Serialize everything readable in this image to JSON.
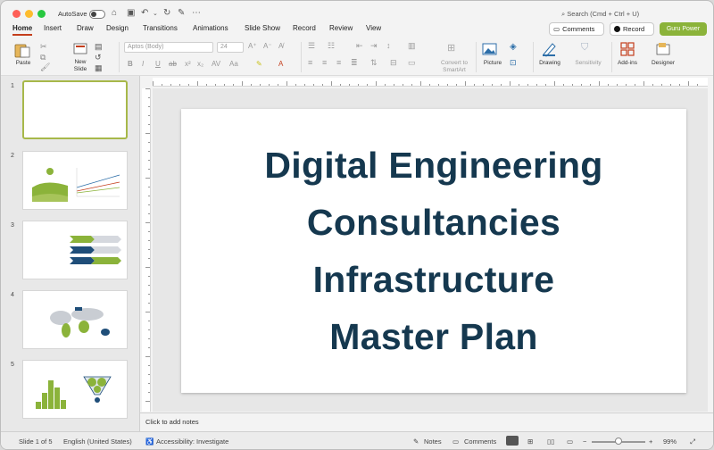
{
  "window": {
    "autosave_label": "AutoSave",
    "search_placeholder": "Search (Cmd + Ctrl + U)"
  },
  "tabs": [
    "Home",
    "Insert",
    "Draw",
    "Design",
    "Transitions",
    "Animations",
    "Slide Show",
    "Record",
    "Review",
    "View"
  ],
  "header_buttons": {
    "comments": "Comments",
    "record": "Record",
    "guru": "Guru Power"
  },
  "ribbon": {
    "paste": "Paste",
    "new_slide_1": "New",
    "new_slide_2": "Slide",
    "font_name": "Aptos (Body)",
    "font_size": "24",
    "convert_1": "Convert to",
    "convert_2": "SmartArt",
    "picture": "Picture",
    "drawing": "Drawing",
    "sensitivity": "Sensitivity",
    "addins": "Add-ins",
    "designer": "Designer"
  },
  "thumbnails": [
    "1",
    "2",
    "3",
    "4",
    "5"
  ],
  "slide": {
    "title_lines": [
      "Digital Engineering",
      "Consultancies",
      "Infrastructure",
      "Master Plan"
    ]
  },
  "notes_placeholder": "Click to add notes",
  "status": {
    "slide_info": "Slide 1 of 5",
    "language": "English (United States)",
    "accessibility": "Accessibility: Investigate",
    "notes": "Notes",
    "comments": "Comments",
    "zoom": "99%"
  },
  "colors": {
    "title_text": "#15384f",
    "accent_green": "#8bb33a",
    "selected_thumb_border": "#a7b84a"
  }
}
